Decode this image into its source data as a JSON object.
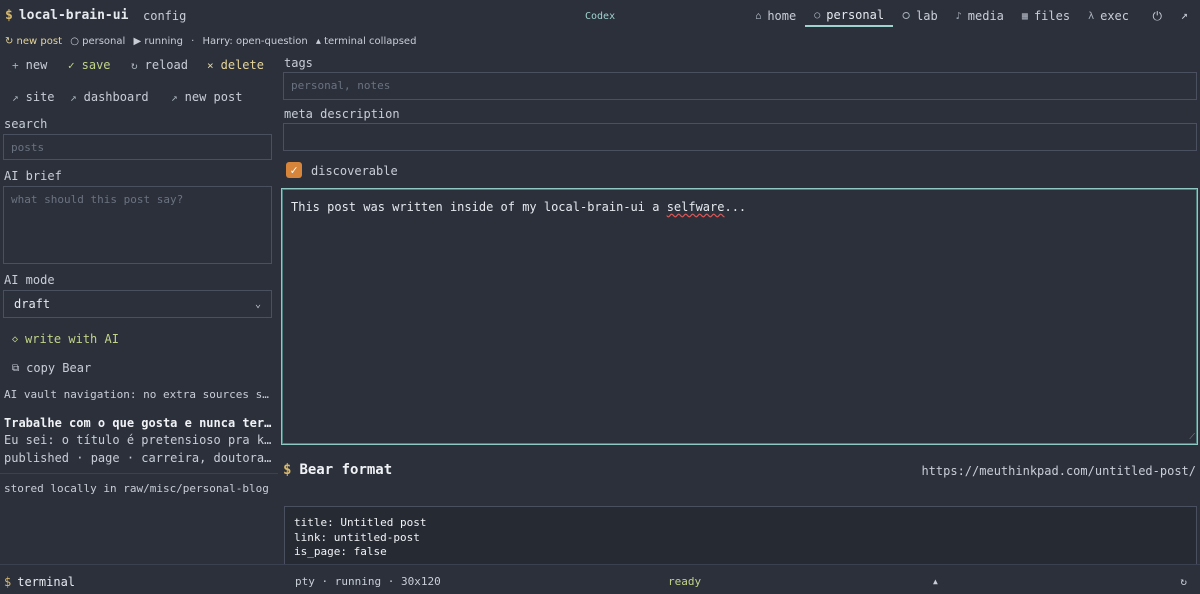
{
  "header": {
    "brand": "local-brain-ui",
    "brand_prefix": "$",
    "config": "config",
    "center_label": "Codex",
    "nav": [
      {
        "icon": "⌂",
        "label": "home"
      },
      {
        "icon": "○",
        "label": "personal",
        "active": true
      },
      {
        "icon": "⭘",
        "label": "lab"
      },
      {
        "icon": "♪",
        "label": "media"
      },
      {
        "icon": "▦",
        "label": "files"
      },
      {
        "icon": "λ",
        "label": "exec"
      }
    ],
    "power_icon": "⏻",
    "external_icon": "↗"
  },
  "status": {
    "new_post": "↻ new post",
    "personal": "○ personal",
    "running": "▶ running",
    "sep": "·",
    "harry": "Harry: open-question",
    "terminal": "▴ terminal collapsed"
  },
  "sidebar": {
    "tools_row1": [
      {
        "icon": "+",
        "label": "new"
      },
      {
        "icon": "✓",
        "label": "save"
      },
      {
        "icon": "↻",
        "label": "reload"
      },
      {
        "icon": "×",
        "label": "delete"
      }
    ],
    "tools_row2": [
      {
        "icon": "↗",
        "label": "site"
      },
      {
        "icon": "↗",
        "label": "dashboard"
      },
      {
        "icon": "↗",
        "label": "new post"
      }
    ],
    "search_label": "search",
    "search_placeholder": "posts",
    "ai_brief_label": "AI brief",
    "ai_brief_placeholder": "what should this post say?",
    "ai_mode_label": "AI mode",
    "ai_mode_value": "draft",
    "write_ai": {
      "icon": "◇",
      "label": "write with AI"
    },
    "copy_bear": {
      "icon": "⧉",
      "label": "copy Bear"
    },
    "vault_nav": "AI vault navigation: no extra sources selected",
    "post_title": "Trabalhe com o que gosta e nunca terá um dia de folga",
    "post_excerpt": "Eu sei: o título é pretensioso pra kct.",
    "post_meta": "published · page · carreira, doutorado",
    "stored": "stored locally in raw/misc/personal-blog"
  },
  "main": {
    "tags_label": "tags",
    "tags_placeholder": "personal, notes",
    "meta_label": "meta description",
    "meta_value": "",
    "discoverable_label": "discoverable",
    "discoverable_checked": true,
    "editor_text_before": "This post was written inside of my local-brain-ui a ",
    "editor_text_misspelled": "selfware",
    "editor_text_after": "...",
    "bear_heading": "Bear format",
    "bear_link": "https://meuthinkpad.com/untitled-post/",
    "bear_lines": [
      "title: Untitled post",
      "link: untitled-post",
      "is_page: false"
    ]
  },
  "footer": {
    "terminal_label": "terminal",
    "pty": "pty · running · 30x120",
    "ready": "ready",
    "up_icon": "▲",
    "refresh_icon": "↻"
  },
  "colors": {
    "accent": "#9fd3cf",
    "dollar": "#d8b86a",
    "checkbox": "#d6853a",
    "ready": "#c2d38a"
  }
}
